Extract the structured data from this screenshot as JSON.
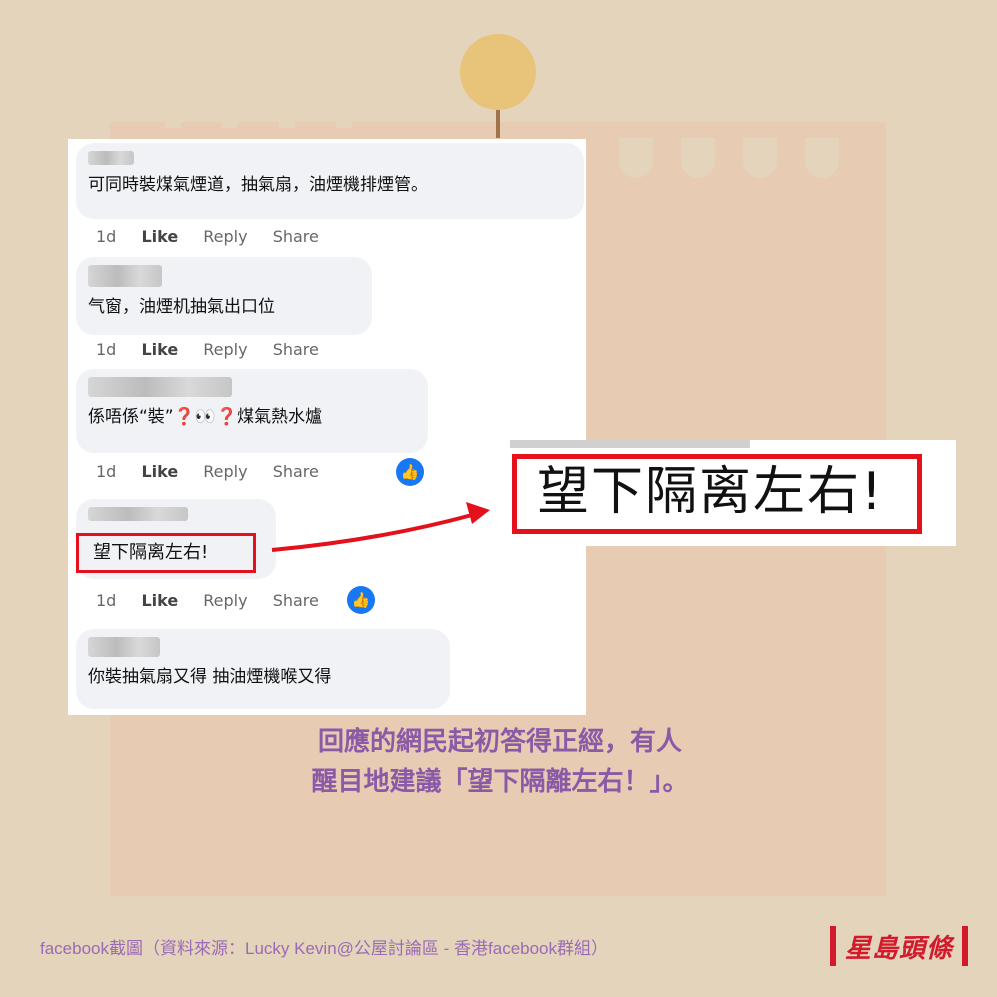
{
  "comments": [
    {
      "text": "可同時裝煤氣煙道，抽氣扇，油煙機排煙管。"
    },
    {
      "text": "气窗，油煙机抽氣出口位"
    },
    {
      "text": "係唔係“裝”❓👀❓煤氣熱水爐"
    },
    {
      "text": "望下隔离左右!"
    },
    {
      "text": "你裝抽氣扇又得 抽油煙機喉又得"
    }
  ],
  "actions": {
    "time": "1d",
    "like": "Like",
    "reply": "Reply",
    "share": "Share"
  },
  "zoom_text": "望下隔离左右!",
  "caption": {
    "line1": "回應的網民起初答得正經，有人",
    "line2": "醒目地建議「望下隔離左右！」。"
  },
  "credit": "facebook截圖（資料來源：Lucky Kevin@公屋討論區 - 香港facebook群組）",
  "logo": "星島頭條",
  "colors": {
    "accent_red": "#e4101b",
    "caption_purple": "#8a5aa6",
    "fb_blue": "#1877f2"
  }
}
